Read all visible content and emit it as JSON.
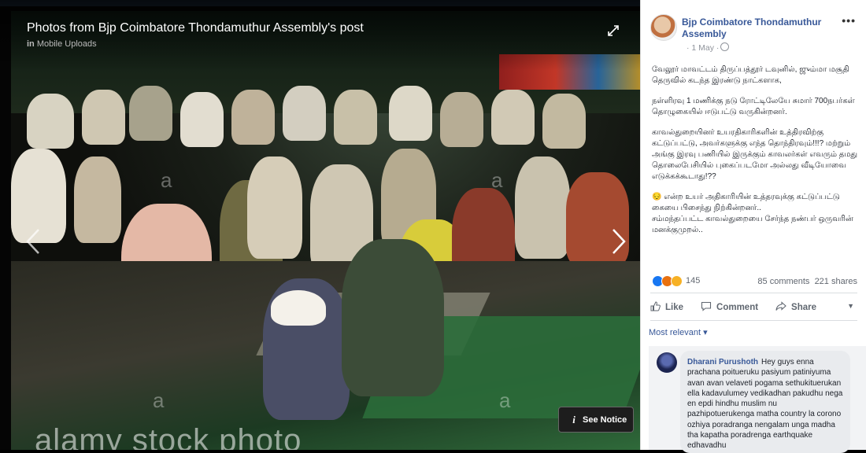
{
  "viewer": {
    "title": "Photos from Bjp Coimbatore Thondamuthur Assembly's post",
    "subtitle_prefix": "in",
    "subtitle_album": "Mobile Uploads",
    "watermark": "alamy stock photo",
    "watermark_a": "a",
    "notice_label": "See Notice",
    "notice_icon": "i"
  },
  "post": {
    "author": "Bjp Coimbatore Thondamuthur Assembly",
    "date": "· 1 May ·",
    "paragraphs": [
      "வேலூர் மாவட்டம் திருப்பத்தூர் டவுனில், ஜும்மா மசூதி தெருவில் கடந்த இரண்டு நாட்களாக,",
      "நள்ளிரவு 1 மணிக்கு நடு ரோட்டிலேயே சுமார் 700நபர்கள் தொழுகையில் ஈடுபட்டு வருகின்றனர்.",
      "காவல்துறையினர் உயரதிகாரிகளின் உத்திரவிற்கு கட்டுப்பட்டு, அவர்களுக்கு எந்த தொந்திரவும்!!!? மற்றும் அங்கு இரவு பணியில் இருக்கும் காவலர்கள் எவரும் தமது தொலைபேசியில் புகைப்படமோ அல்லது வீடியோவை எடுக்கக்கூடாது!??",
      "😔 என்ற உயர் அதிகாரியின் உத்தரவுக்கு கட்டுப்பட்டு கையை பிசைந்து நிற்கின்றனர்..",
      "சம்மந்தப்பட்ட காவல்துறையை சேர்ந்த நண்பர் ஒருவரின் மனக்குமுறல்.."
    ],
    "reaction_count": "145",
    "comments_count": "85 comments",
    "shares_count": "221 shares",
    "actions": {
      "like": "Like",
      "comment": "Comment",
      "share": "Share"
    },
    "sort_label": "Most relevant ▾"
  },
  "comment": {
    "author": "Dharani Purushoth",
    "text": "Hey guys enna prachana poitueruku pasiyum patiniyuma avan avan velaveti pogama sethukituerukan ella kadavulumey vedikadhan pakudhu nega en epdi hindhu muslim nu pazhipotuerukenga matha country la corono ozhiya poradranga nengalam unga madha tha kapatha poradrenga earthquake edhavadhu"
  },
  "colors": {
    "link_blue": "#385898",
    "reaction_like": "#1877f2",
    "reaction_angry": "#e9710f",
    "reaction_sad": "#f7b125"
  },
  "icons": [
    "expand-icon",
    "prev-arrow-icon",
    "next-arrow-icon",
    "info-icon",
    "globe-icon",
    "more-icon",
    "like-icon",
    "comment-icon",
    "share-icon",
    "caret-down-icon"
  ]
}
